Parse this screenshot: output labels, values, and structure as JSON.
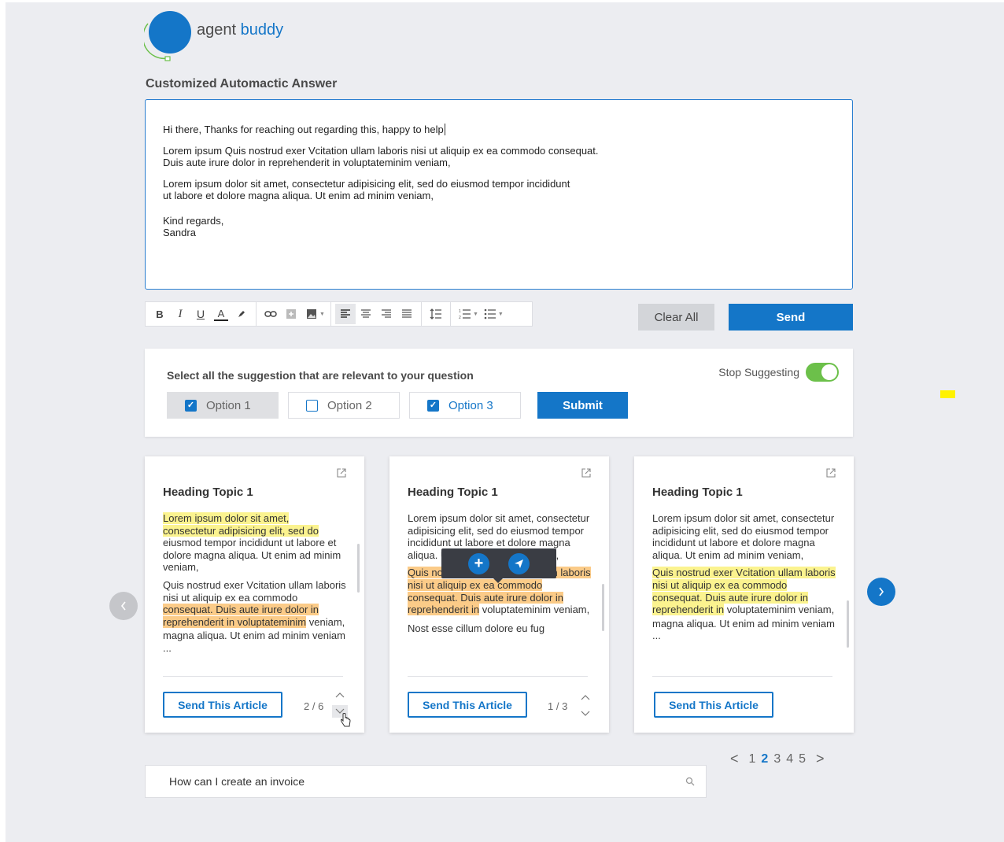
{
  "brand": {
    "name_part1": "agent",
    "name_part2": "buddy",
    "color": "#1476c8",
    "arc_color": "#6cc04a"
  },
  "section_title": "Customized Automactic Answer",
  "editor": {
    "line1": "Hi there, Thanks for reaching out regarding this, happy to help",
    "para1": "Lorem ipsum Quis nostrud exer Vcitation ullam laboris nisi ut aliquip ex ea commodo consequat.\nDuis aute irure dolor in reprehenderit in voluptateminim veniam,",
    "para2": "Lorem ipsum dolor sit amet, consectetur adipisicing elit, sed do eiusmod tempor incididunt\nut labore et dolore magna aliqua. Ut enim ad minim veniam,",
    "signoff": "Kind regards,\nSandra"
  },
  "toolbar": {
    "bold": "B",
    "italic": "I",
    "underline": "U",
    "font_color": "A",
    "highlighter_icon": "marker-icon",
    "link_icon": "link-icon",
    "insert_icon": "add-box-icon",
    "image_icon": "image-icon",
    "align_left_icon": "align-left-icon",
    "align_center_icon": "align-center-icon",
    "align_right_icon": "align-right-icon",
    "align_justify_icon": "align-justify-icon",
    "line_height_icon": "line-spacing-icon",
    "ordered_list_icon": "numbered-list-icon",
    "bullet_list_icon": "bullet-list-icon"
  },
  "actions": {
    "clear_all": "Clear All",
    "send": "Send"
  },
  "suggestions": {
    "prompt": "Select all the suggestion that are relevant to your question",
    "stop_label": "Stop Suggesting",
    "stop_on": true,
    "options": [
      {
        "label": "Option 1",
        "checked": true
      },
      {
        "label": "Option 2",
        "checked": false
      },
      {
        "label": "Option 3",
        "checked": true
      }
    ],
    "submit": "Submit"
  },
  "cards": [
    {
      "title": "Heading Topic 1",
      "p1_hl": "Lorem ipsum dolor sit amet,",
      "p1_hl2": "consectetur adipisicing elit, sed do",
      "p1_rest": "eiusmod tempor incididunt ut labore et dolore magna aliqua. Ut enim ad minim veniam,",
      "p2_start": "Quis nostrud exer Vcitation ullam laboris nisi ut aliquip ex ea commodo",
      "p2_hl": "consequat. Duis aute irure dolor in reprehenderit in voluptateminim",
      "p2_rest": "veniam,",
      "p3": "magna aliqua. Ut enim ad minim veniam ...",
      "button": "Send This Article",
      "count": "2 / 6"
    },
    {
      "title": "Heading Topic 1",
      "p1": "Lorem ipsum dolor sit amet, consectetur adipisicing elit, sed do eiusmod tempor incididunt ut labore et dolore magna aliqua. Ut enim ad minim veniam,",
      "p2_hl": "Quis nostrud exer Vcitation ullam laboris nisi ut aliquip ex ea commodo consequat. Duis aute irure dolor in reprehenderit in",
      "p2_rest": "voluptateminim veniam,",
      "p3": "Nost esse cillum dolore eu fug",
      "button": "Send This Article",
      "count": "1 / 3"
    },
    {
      "title": "Heading Topic 1",
      "p1": "Lorem ipsum dolor sit amet, consectetur adipisicing elit, sed do eiusmod tempor incididunt ut labore et dolore magna aliqua. Ut enim ad minim veniam,",
      "p2_hl": "Quis nostrud exer Vcitation ullam laboris nisi ut aliquip ex ea commodo consequat. Duis aute irure dolor in reprehenderit in",
      "p2_rest": "voluptateminim veniam,",
      "p3": "magna aliqua. Ut enim ad minim veniam ...",
      "button": "Send This Article"
    }
  ],
  "popover": {
    "add_icon": "plus-icon",
    "send_icon": "paper-plane-icon"
  },
  "pagination": {
    "prev": "<",
    "pages": [
      "1",
      "2",
      "3",
      "4",
      "5"
    ],
    "current": "2",
    "next": ">"
  },
  "search": {
    "value": "How can I create an invoice",
    "icon": "search-icon"
  }
}
